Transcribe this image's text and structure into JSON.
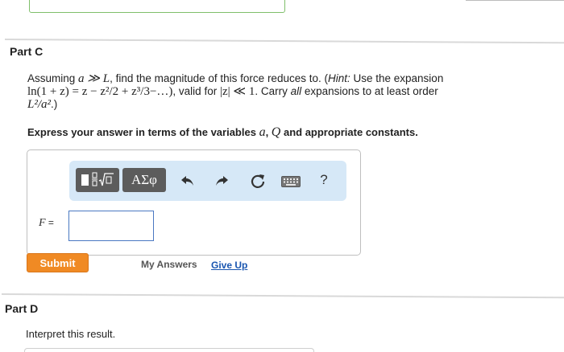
{
  "part_c": {
    "title": "Part C",
    "question": {
      "intro": "Assuming ",
      "condition": "a ≫ L",
      "mid": ", find the magnitude of this force reduces to. (",
      "hint_label": "Hint:",
      "hint_text": " Use the expansion",
      "expansion": "ln(1 + z) = z − z²/2 + z³/3−…)",
      "validity_prefix": ", valid for ",
      "validity": "|z| ≪ 1",
      "carry_prefix": ". Carry ",
      "carry_em": "all",
      "carry_suffix": " expansions to at least order",
      "order": "L²/a²",
      "closing": ".)"
    },
    "instruction": {
      "prefix": "Express your answer in terms of the variables ",
      "var1": "a",
      "sep": ", ",
      "var2": "Q",
      "suffix": " and appropriate constants."
    },
    "toolbar": {
      "greek_label": "ΑΣφ",
      "help_label": "?"
    },
    "answer": {
      "variable": "F",
      "equals": " =",
      "value": ""
    },
    "submit_label": "Submit",
    "my_answers_label": "My Answers",
    "give_up_label": "Give Up"
  },
  "part_d": {
    "title": "Part D",
    "prompt": "Interpret this result."
  },
  "colors": {
    "submit": "#f08a24",
    "toolbar_bg": "#d6e8f7",
    "link": "#1a56b0",
    "input_border": "#4a78c2"
  }
}
